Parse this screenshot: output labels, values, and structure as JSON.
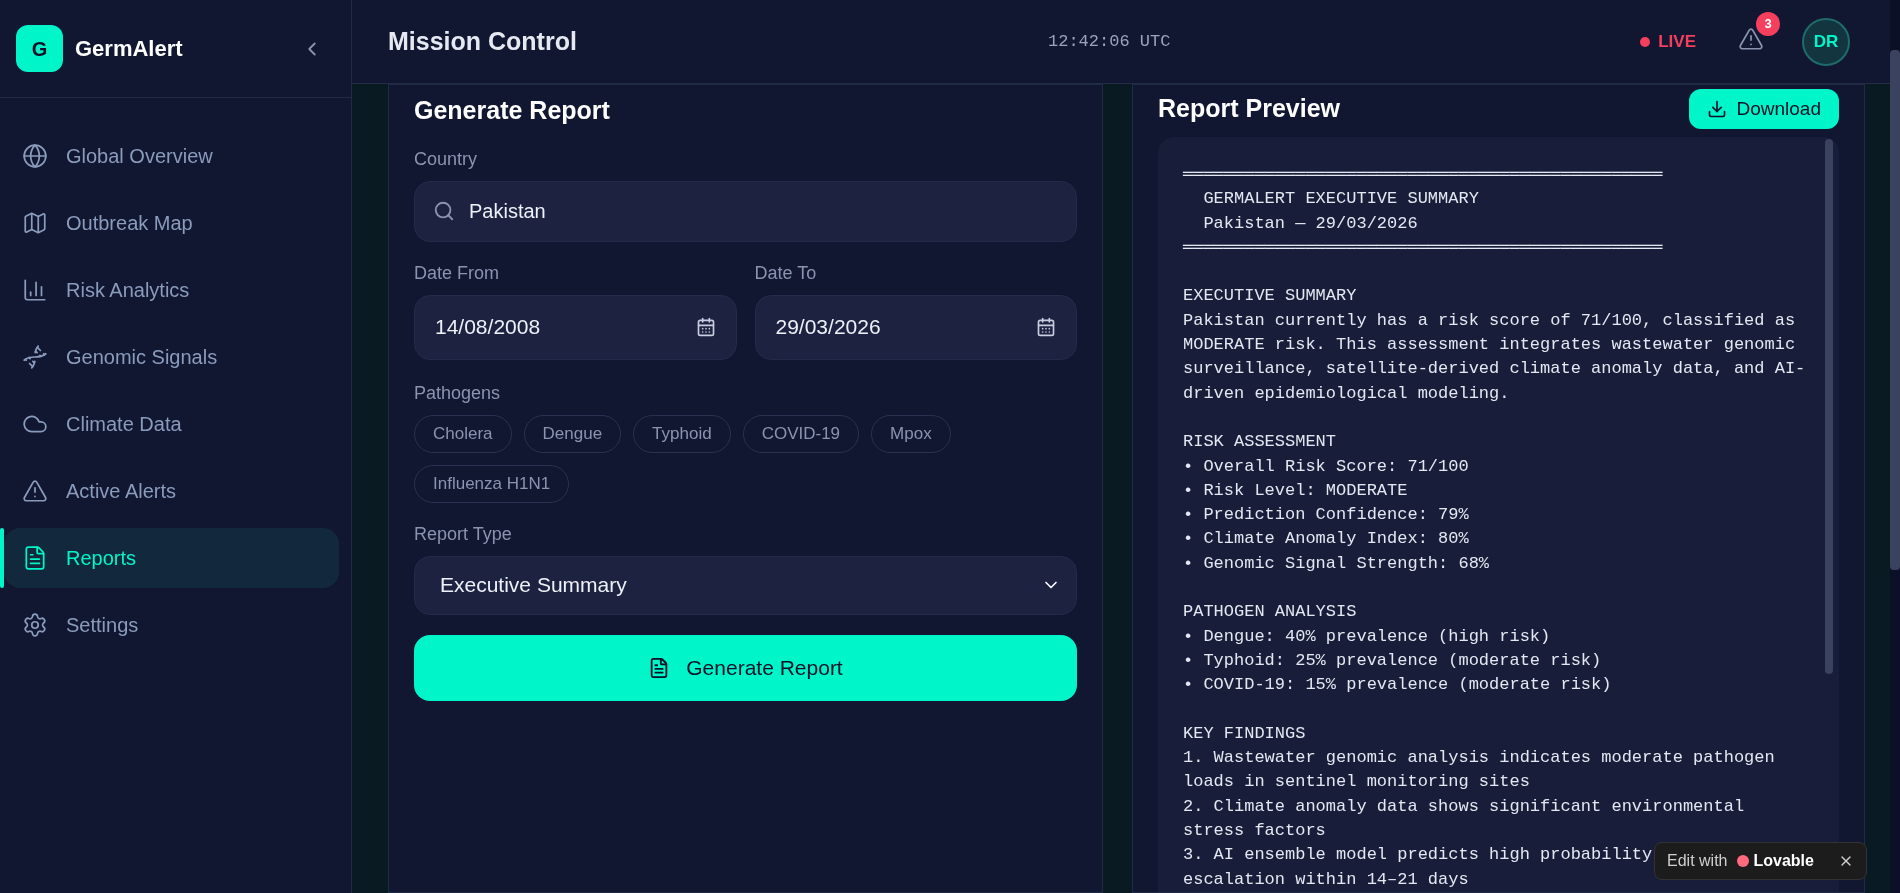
{
  "brand": {
    "logo": "G",
    "name": "GermAlert"
  },
  "sidebar": {
    "items": [
      {
        "label": "Global Overview",
        "selected": false
      },
      {
        "label": "Outbreak Map",
        "selected": false
      },
      {
        "label": "Risk Analytics",
        "selected": false
      },
      {
        "label": "Genomic Signals",
        "selected": false
      },
      {
        "label": "Climate Data",
        "selected": false
      },
      {
        "label": "Active Alerts",
        "selected": false
      },
      {
        "label": "Reports",
        "selected": true
      },
      {
        "label": "Settings",
        "selected": false
      }
    ]
  },
  "header": {
    "title": "Mission Control",
    "clock": "12:42:06 UTC",
    "live": "LIVE",
    "alert_count": "3",
    "avatar": "DR"
  },
  "form": {
    "title": "Generate Report",
    "country": {
      "label": "Country",
      "value": "Pakistan"
    },
    "date_from": {
      "label": "Date From",
      "value": "14/08/2008"
    },
    "date_to": {
      "label": "Date To",
      "value": "29/03/2026"
    },
    "pathogens": {
      "label": "Pathogens",
      "items": [
        {
          "label": "Cholera",
          "selected": false
        },
        {
          "label": "Dengue",
          "selected": false
        },
        {
          "label": "Typhoid",
          "selected": false
        },
        {
          "label": "COVID-19",
          "selected": false
        },
        {
          "label": "Mpox",
          "selected": false
        },
        {
          "label": "Influenza H1N1",
          "selected": false
        }
      ]
    },
    "report_type": {
      "label": "Report Type",
      "value": "Executive Summary"
    },
    "button": "Generate Report"
  },
  "preview": {
    "title": "Report Preview",
    "download": "Download",
    "rule_top": "═══════════════════════════════════════════════",
    "banner": [
      "  GERMALERT EXECUTIVE SUMMARY",
      "  Pakistan — 29/03/2026"
    ],
    "rule_bottom": "═══════════════════════════════════════════════",
    "sections": [
      {
        "heading": "EXECUTIVE SUMMARY",
        "lines": [
          "Pakistan currently has a risk score of 71/100, classified as",
          "MODERATE risk. This assessment integrates wastewater genomic",
          "surveillance, satellite-derived climate anomaly data, and AI-",
          "driven epidemiological modeling."
        ]
      },
      {
        "heading": "RISK ASSESSMENT",
        "lines": [
          "• Overall Risk Score: 71/100",
          "• Risk Level: MODERATE",
          "• Prediction Confidence: 79%",
          "• Climate Anomaly Index: 80%",
          "• Genomic Signal Strength: 68%"
        ]
      },
      {
        "heading": "PATHOGEN ANALYSIS",
        "lines": [
          "• Dengue: 40% prevalence (high risk)",
          "• Typhoid: 25% prevalence (moderate risk)",
          "• COVID-19: 15% prevalence (moderate risk)"
        ]
      },
      {
        "heading": "KEY FINDINGS",
        "lines": [
          "1. Wastewater genomic analysis indicates moderate pathogen",
          "loads in sentinel monitoring sites",
          "2. Climate anomaly data shows significant environmental",
          "stress factors",
          "3. AI ensemble model predicts high probability",
          "escalation within 14–21 days"
        ]
      }
    ]
  },
  "edit_badge": {
    "text": "Edit with",
    "brand": "Lovable"
  }
}
